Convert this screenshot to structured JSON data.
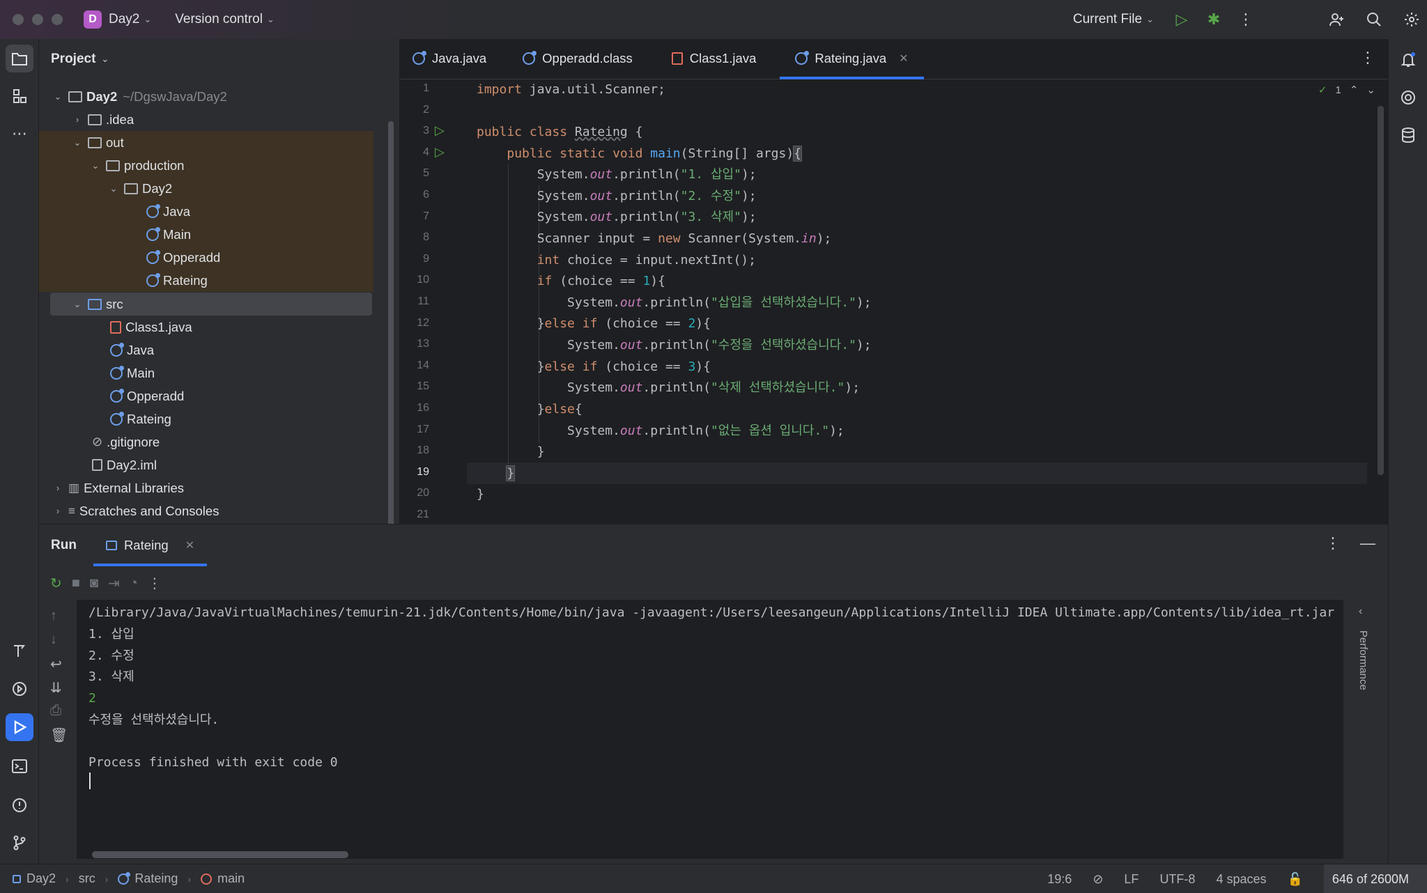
{
  "titlebar": {
    "project_initial": "D",
    "project_name": "Day2",
    "vcs": "Version control",
    "run_config": "Current File"
  },
  "project_panel": {
    "title": "Project",
    "root_name": "Day2",
    "root_path": "~/DgswJava/Day2",
    "items": [
      {
        "label": ".idea"
      },
      {
        "label": "out"
      },
      {
        "label": "production"
      },
      {
        "label": "Day2"
      },
      {
        "label": "Java"
      },
      {
        "label": "Main"
      },
      {
        "label": "Opperadd"
      },
      {
        "label": "Rateing"
      },
      {
        "label": "src"
      },
      {
        "label": "Class1.java"
      },
      {
        "label": "Java"
      },
      {
        "label": "Main"
      },
      {
        "label": "Opperadd"
      },
      {
        "label": "Rateing"
      },
      {
        "label": ".gitignore"
      },
      {
        "label": "Day2.iml"
      },
      {
        "label": "External Libraries"
      },
      {
        "label": "Scratches and Consoles"
      }
    ]
  },
  "editor": {
    "tabs": [
      {
        "label": "Java.java"
      },
      {
        "label": "Opperadd.class"
      },
      {
        "label": "Class1.java"
      },
      {
        "label": "Rateing.java"
      }
    ],
    "inspection_count": "1",
    "line_numbers": [
      "1",
      "2",
      "3",
      "4",
      "5",
      "6",
      "7",
      "8",
      "9",
      "10",
      "11",
      "12",
      "13",
      "14",
      "15",
      "16",
      "17",
      "18",
      "19",
      "20",
      "21"
    ],
    "code": {
      "l1_kw": "import",
      "l1_rest": " java.util.Scanner;",
      "l3_kw": "public class",
      "l3_name": "Rateing",
      "l3_rest": " {",
      "l4_kw": "public static void",
      "l4_fn": "main",
      "l4_rest": "(String[] args)",
      "l4_brace": "{",
      "sys": "System.",
      "out": "out",
      "println": ".println(",
      "l5_str": "\"1. 삽입\"",
      "l6_str": "\"2. 수정\"",
      "l7_str": "\"3. 삭제\"",
      "end": ");",
      "l8_a": "Scanner input = ",
      "l8_new": "new",
      "l8_b": " Scanner(System.",
      "l8_in": "in",
      "l8_c": ");",
      "l9_kw": "int",
      "l9_rest": " choice = input.nextInt();",
      "l10_kw": "if",
      "l10_a": " (choice == ",
      "l10_n": "1",
      "l10_b": "){",
      "l11_str": "\"삽입을 선택하셨습니다.\"",
      "l12_a": "}",
      "l12_kw": "else if",
      "l12_b": " (choice == ",
      "l12_n": "2",
      "l12_c": "){",
      "l13_str": "\"수정을 선택하셨습니다.\"",
      "l14_a": "}",
      "l14_kw": "else if",
      "l14_b": " (choice == ",
      "l14_n": "3",
      "l14_c": "){",
      "l15_str": "\"삭제 선택하셨습니다.\"",
      "l16_a": "}",
      "l16_kw": "else",
      "l16_b": "{",
      "l17_str": "\"없는 옵션 입니다.\"",
      "l18": "}",
      "l19": "}",
      "l20": "}"
    }
  },
  "run_panel": {
    "title": "Run",
    "tab_label": "Rateing",
    "performance_label": "Performance",
    "console_lines": [
      "/Library/Java/JavaVirtualMachines/temurin-21.jdk/Contents/Home/bin/java -javaagent:/Users/leesangeun/Applications/IntelliJ IDEA Ultimate.app/Contents/lib/idea_rt.jar",
      "1. 삽입",
      "2. 수정",
      "3. 삭제",
      "2",
      "수정을 선택하셨습니다.",
      "",
      "Process finished with exit code 0"
    ]
  },
  "statusbar": {
    "crumbs": [
      "Day2",
      "src",
      "Rateing",
      "main"
    ],
    "position": "19:6",
    "line_ending": "LF",
    "encoding": "UTF-8",
    "indent": "4 spaces",
    "memory": "646 of 2600M"
  }
}
